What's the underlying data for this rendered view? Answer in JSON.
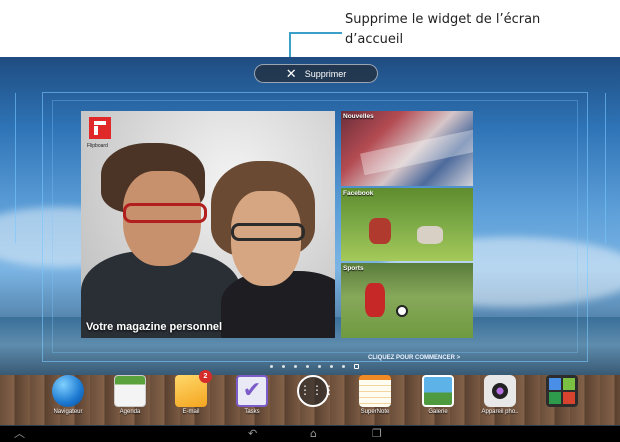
{
  "callout": {
    "text": "Supprime le widget de l’écran d’accueil"
  },
  "remove_bar": {
    "label": "Supprimer"
  },
  "widget": {
    "brand": "Flipboard",
    "title": "Votre magazine personnel",
    "tiles": [
      "Nouvelles",
      "Facebook",
      "Sports"
    ],
    "cta": "CLIQUEZ POUR COMMENCER >"
  },
  "dock": {
    "apps": [
      {
        "label": "Navigateur",
        "icon": "browser-globe-icon"
      },
      {
        "label": "Agenda",
        "icon": "calendar-icon"
      },
      {
        "label": "E-mail",
        "icon": "envelope-icon",
        "badge": "2"
      },
      {
        "label": "Tasks",
        "icon": "checkbox-icon"
      },
      {
        "label": "",
        "icon": "app-drawer-icon"
      },
      {
        "label": "SuperNote",
        "icon": "notebook-icon"
      },
      {
        "label": "Galerie",
        "icon": "gallery-icon"
      },
      {
        "label": "Appareil pho..",
        "icon": "camera-icon"
      },
      {
        "label": "",
        "icon": "google-apps-folder-icon"
      }
    ]
  },
  "navbar": {
    "icons": [
      "recent-menu-icon",
      "back-icon",
      "home-icon",
      "recent-apps-icon"
    ]
  },
  "colors": {
    "callout_line": "#3aa0c8",
    "badge": "#d62b2b",
    "flipboard_red": "#e12828"
  }
}
